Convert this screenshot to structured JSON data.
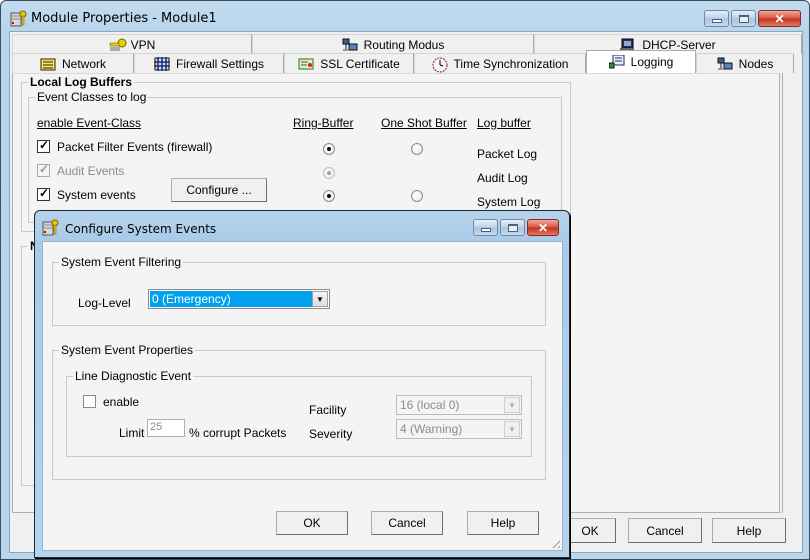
{
  "main_window": {
    "title": "Module Properties - Module1",
    "icon": "server-key-icon",
    "caption_buttons": [
      "minimize",
      "maximize",
      "close"
    ]
  },
  "tabs": {
    "row_back": [
      {
        "label": "VPN",
        "icon": "key-icon"
      },
      {
        "label": "Routing Modus",
        "icon": "network-computers-icon"
      },
      {
        "label": "DHCP-Server",
        "icon": "dhcp-server-icon"
      }
    ],
    "row_front": [
      {
        "label": "Network",
        "icon": "folder-network-icon"
      },
      {
        "label": "Firewall Settings",
        "icon": "firewall-icon"
      },
      {
        "label": "SSL Certificate",
        "icon": "certificate-icon"
      },
      {
        "label": "Time Synchronization",
        "icon": "clock-icon"
      },
      {
        "label": "Logging",
        "icon": "logging-icon",
        "active": true
      },
      {
        "label": "Nodes",
        "icon": "nodes-icon"
      }
    ]
  },
  "logging_panel": {
    "local_log_buffers_title": "Local Log Buffers",
    "event_classes_title": "Event Classes to log",
    "columns": {
      "enable": "enable Event-Class",
      "ring": "Ring-Buffer",
      "oneshot": "One Shot Buffer",
      "logbuffer": "Log buffer"
    },
    "rows": [
      {
        "label": "Packet Filter Events (firewall)",
        "checked": true,
        "disabled": false,
        "ring_buffer": true,
        "one_shot": false,
        "log_buffer": "Packet Log"
      },
      {
        "label": "Audit Events",
        "checked": true,
        "disabled": true,
        "ring_buffer": true,
        "one_shot": null,
        "log_buffer": "Audit Log"
      },
      {
        "label": "System events",
        "checked": true,
        "disabled": false,
        "ring_buffer": true,
        "one_shot": false,
        "log_buffer": "System Log"
      }
    ],
    "configure_button": "Configure ...",
    "second_group_partial": "N"
  },
  "main_buttons": {
    "ok": "OK",
    "cancel": "Cancel",
    "help": "Help"
  },
  "dialog": {
    "title": "Configure System Events",
    "icon": "server-key-icon",
    "filtering": {
      "title": "System Event Filtering",
      "log_level_label": "Log-Level",
      "log_level_value": "0 (Emergency)"
    },
    "properties": {
      "title": "System Event Properties",
      "line_diag_title": "Line Diagnostic Event",
      "enable_label": "enable",
      "enable_checked": false,
      "limit_label": "Limit",
      "limit_value": "25",
      "limit_suffix": "% corrupt Packets",
      "facility_label": "Facility",
      "facility_value": "16 (local 0)",
      "severity_label": "Severity",
      "severity_value": "4 (Warning)"
    },
    "buttons": {
      "ok": "OK",
      "cancel": "Cancel",
      "help": "Help"
    }
  }
}
